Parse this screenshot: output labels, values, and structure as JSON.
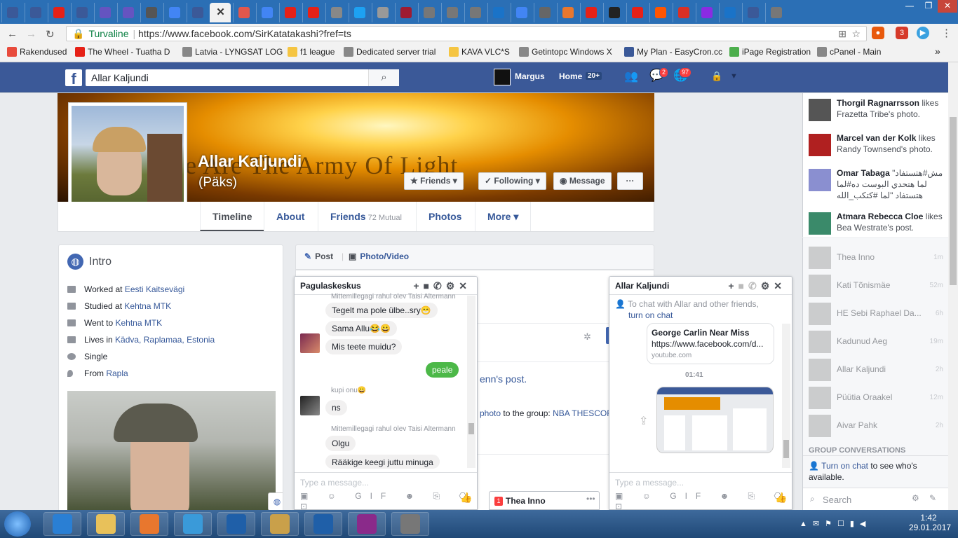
{
  "browser": {
    "tab_count_icons": [
      "facebook",
      "facebook",
      "youtube",
      "facebook",
      "jira",
      "jira",
      "speed",
      "google",
      "facebook",
      "close",
      "pdf",
      "translate",
      "youtube",
      "youtube",
      "uu",
      "twitter",
      "doc",
      "lv",
      "wikipedia",
      "yt",
      "yt",
      "tv-kava",
      "google",
      "feather",
      "eclipse",
      "youtube",
      "smiley",
      "youtube",
      "soundcloud",
      "mail",
      "skype",
      "globe",
      "facebook",
      "wikipedia"
    ],
    "active_tab_glyph": "✕",
    "security_label": "Turvaline",
    "url": "https://www.facebook.com/SirKatatakashi?fref=ts",
    "window_controls": [
      "—",
      "❐",
      "✕"
    ],
    "bookmarks": [
      {
        "label": "Rakendused",
        "color": "#e84b3c"
      },
      {
        "label": "The Wheel - Tuatha D",
        "color": "#e62117"
      },
      {
        "label": "Latvia - LYNGSAT LOG",
        "color": "#888888"
      },
      {
        "label": "f1 league",
        "color": "#f5c542"
      },
      {
        "label": "Dedicated server trial",
        "color": "#888888"
      },
      {
        "label": "KAVA VLC*S",
        "color": "#f5c542"
      },
      {
        "label": "Getintopc Windows X",
        "color": "#888888"
      },
      {
        "label": "My Plan - EasyCron.cc",
        "color": "#3b5998"
      },
      {
        "label": "iPage Registration",
        "color": "#4cae4c"
      },
      {
        "label": "cPanel - Main",
        "color": "#888888"
      }
    ],
    "bookmarks_more": "»",
    "ext_badge": "3"
  },
  "fb": {
    "search_value": "Allar Kaljundi",
    "user_name": "Margus",
    "home_label": "Home",
    "home_count": "20+",
    "messages_badge": "2",
    "notif_badge": "97"
  },
  "profile": {
    "name": "Allar Kaljundi",
    "nickname": "(Päks)",
    "cover_text": "We Are The Army Of Light",
    "friends_btn": "Friends",
    "following_btn": "Following",
    "message_btn": "Message",
    "more_btn": "···",
    "tabs": {
      "timeline": "Timeline",
      "about": "About",
      "friends": "Friends",
      "friends_mutual": "72 Mutual",
      "photos": "Photos",
      "more": "More"
    }
  },
  "intro": {
    "title": "Intro",
    "worked_prefix": "Worked at",
    "worked_at": "Eesti Kaitsevägi",
    "studied_prefix": "Studied at",
    "studied_at": "Kehtna MTK",
    "went_prefix": "Went to",
    "went_to": "Kehtna MTK",
    "lives_prefix": "Lives in",
    "lives_in": "Kädva, Raplamaa, Estonia",
    "relationship": "Single",
    "from_prefix": "From",
    "from": "Rapla"
  },
  "composer": {
    "post_label": "Post",
    "photo_label": "Photo/Video"
  },
  "feed_fragments": {
    "shared_post": "enn's post.",
    "photo_prefix": "photo",
    "photo_mid": "to the group:",
    "group_name": "NBA THESCOR"
  },
  "chat1": {
    "title": "Pagulaskeskus",
    "sender_a": "Mittemillegagi rahul olev Taisi Altermann",
    "msg1": "Tegelt ma pole ülbe..sry😁",
    "msg2": "Sama Allu😂😀",
    "msg3": "Mis teete muidu?",
    "msg_me": "peale",
    "sender_b": "kupi onu😀",
    "msg4": "ns",
    "sender_c": "Mittemillegagi rahul olev Taisi Altermann",
    "msg5": "Olgu",
    "msg6": "Rääkige keegi juttu minuga",
    "input_placeholder": "Type a message...",
    "toolbar_icons": "▣ ☺ GIF ☻ ⎘ ⎔ ⊡",
    "like_glyph": "👍"
  },
  "chat2": {
    "title": "Allar Kaljundi",
    "notice": "To chat with Allar and other friends,",
    "notice_link": "turn on chat",
    "link_title": "George Carlin Near Miss",
    "link_url": "https://www.facebook.com/d...",
    "link_domain": "youtube.com",
    "timestamp": "01:41",
    "input_placeholder": "Type a message...",
    "toolbar_icons": "▣ ☺ GIF ☻ ⎘ ⎔ ⊡",
    "like_glyph": "👍"
  },
  "minimized_chat": {
    "badge": "1",
    "name": "Thea Inno",
    "more": "•••"
  },
  "ticker": [
    {
      "name": "Thorgil Ragnarrsson",
      "text": "likes Frazetta Tribe's photo.",
      "color": "#555555"
    },
    {
      "name": "Marcel van der Kolk",
      "text": "likes Randy Townsend's photo.",
      "color": "#b02020"
    },
    {
      "name": "Omar Tabaga",
      "text": "\"مش#هتستفاد لما هتحدي البوست ده#لما هتستفاد \"لما #كتكب_الله",
      "color": "#8a8fd0"
    },
    {
      "name": "Atmara Rebecca Cloe",
      "text": "likes Bea Westrate's post.",
      "color": "#3a8a6a"
    }
  ],
  "chat_contacts": [
    {
      "name": "Thea Inno",
      "time": "1m"
    },
    {
      "name": "Kati Tõnismäe",
      "time": "52m"
    },
    {
      "name": "HE Sebi Raphael Da...",
      "time": "6h"
    },
    {
      "name": "Kadunud Aeg",
      "time": "19m"
    },
    {
      "name": "Allar Kaljundi",
      "time": "2h"
    },
    {
      "name": "Püütia Oraakel",
      "time": "12m"
    },
    {
      "name": "Aivar Pahk",
      "time": "2h"
    }
  ],
  "sidebar": {
    "group_header": "GROUP CONVERSATIONS",
    "turn_on_link": "Turn on chat",
    "turn_on_rest": "to see who's available.",
    "search_placeholder": "Search"
  },
  "taskbar": {
    "time": "1:42",
    "date": "29.01.2017",
    "apps": [
      "#2a7fd4",
      "#e8c15a",
      "#e8772e",
      "#3a9ad9",
      "#1f5fa8",
      "#c9a04a",
      "#1f5fa8",
      "#8a2a8a",
      "#777777"
    ]
  },
  "colors": {
    "fb_blue": "#3b5998",
    "link": "#365899",
    "chat_green": "#4cb848"
  }
}
